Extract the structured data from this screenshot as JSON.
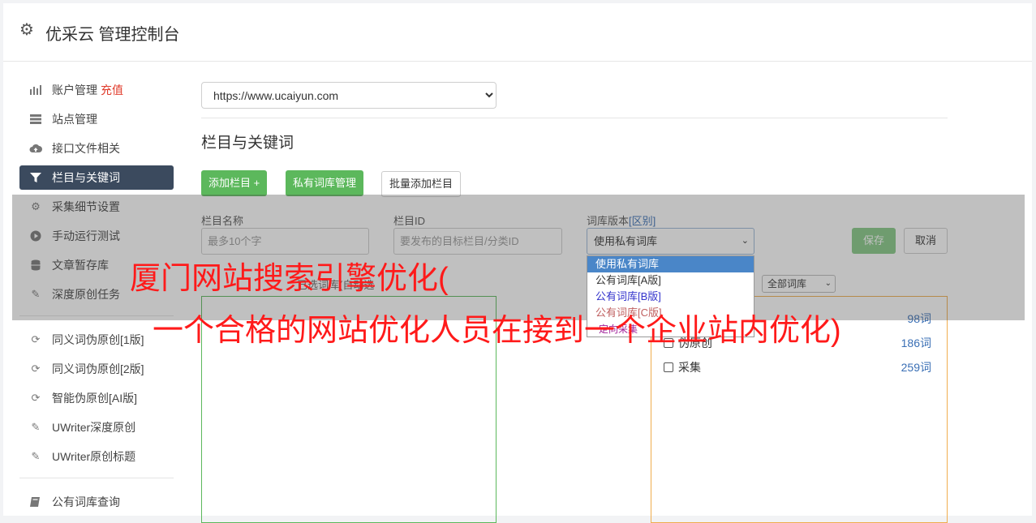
{
  "header": {
    "title": "优采云 管理控制台",
    "icon": "gear-icon"
  },
  "sidebar": {
    "items": [
      {
        "label": "账户管理",
        "badge": "充值",
        "icon": "bar-chart-icon"
      },
      {
        "label": "站点管理",
        "icon": "server-icon"
      },
      {
        "label": "接口文件相关",
        "icon": "cloud-upload-icon"
      },
      {
        "label": "栏目与关键词",
        "icon": "filter-icon",
        "active": true
      },
      {
        "label": "采集细节设置",
        "icon": "cogs-icon"
      },
      {
        "label": "手动运行测试",
        "icon": "play-circle-icon"
      },
      {
        "label": "文章暂存库",
        "icon": "database-icon"
      },
      {
        "label": "深度原创任务",
        "icon": "edit-icon"
      },
      {
        "label": "同义词伪原创[1版]",
        "icon": "refresh-icon"
      },
      {
        "label": "同义词伪原创[2版]",
        "icon": "refresh-icon"
      },
      {
        "label": "智能伪原创[AI版]",
        "icon": "refresh-icon"
      },
      {
        "label": "UWriter深度原创",
        "icon": "edit-icon"
      },
      {
        "label": "UWriter原创标题",
        "icon": "edit-icon"
      },
      {
        "label": "公有词库查询",
        "icon": "book-icon"
      }
    ]
  },
  "site_select": {
    "value": "https://www.ucaiyun.com"
  },
  "section": {
    "title": "栏目与关键词"
  },
  "toolbar": {
    "add_column": "添加栏目 +",
    "private_lib": "私有词库管理",
    "batch_add": "批量添加栏目"
  },
  "form": {
    "name_label": "栏目名称",
    "name_placeholder": "最多10个字",
    "id_label": "栏目ID",
    "id_placeholder": "要发布的目标栏目/分类ID",
    "lib_label": "词库版本",
    "lib_diff": "[区别]",
    "lib_value": "使用私有词库",
    "save": "保存",
    "cancel": "取消"
  },
  "dropdown": {
    "options": [
      "使用私有词库",
      "公有词库[A版]",
      "公有词库[B版]",
      "公有词库[C版]",
      "定向采集"
    ]
  },
  "lists": {
    "left_caption": "已选词库(自动选",
    "filter": "全部词库",
    "rows": [
      {
        "name": "",
        "count": "98词"
      },
      {
        "name": "伪原创",
        "count": "186词"
      },
      {
        "name": "采集",
        "count": "259词"
      }
    ]
  },
  "overlay_text": {
    "line1": "厦门网站搜索引擎优化(",
    "line2": "一个合格的网站优化人员在接到一个企业站内优化)"
  },
  "colors": {
    "accent": "#3b4a5e",
    "green": "#5cb85c",
    "orange": "#f0ad4e",
    "red_text": "#ff1a1a"
  }
}
